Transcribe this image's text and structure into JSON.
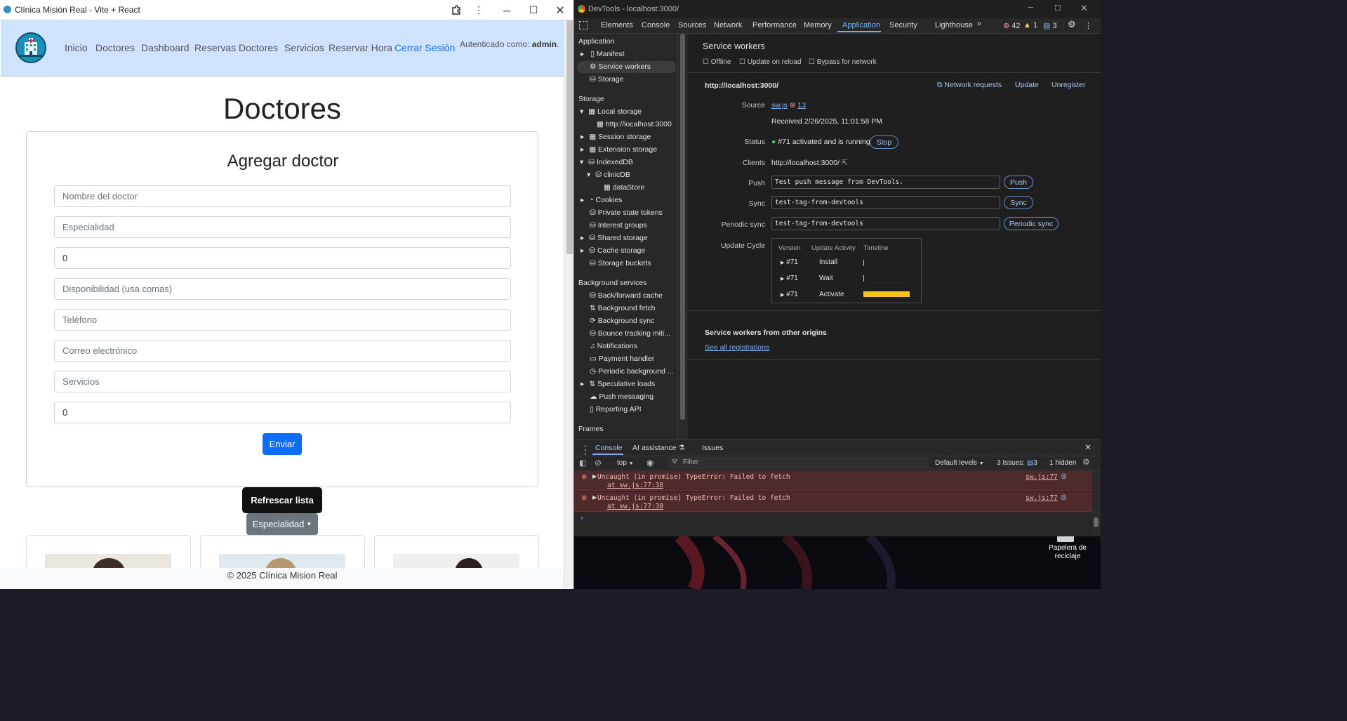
{
  "app": {
    "window_title": "Clínica Misión Real - Vite + React",
    "nav": [
      "Inicio",
      "Doctores",
      "Dashboard",
      "Reservas",
      "Doctores",
      "Servicios",
      "Reservar Hora"
    ],
    "logout": "Cerrar Sesión",
    "auth_prefix": "Autenticado como:",
    "auth_user": "admin",
    "page_title": "Doctores",
    "form": {
      "title": "Agregar doctor",
      "name_placeholder": "Nombre del doctor",
      "specialty_placeholder": "Especialidad",
      "num1_value": "0",
      "availability_placeholder": "Disponibilidad (usa comas)",
      "phone_placeholder": "Teléfono",
      "email_placeholder": "Correo electrónico",
      "services_placeholder": "Servicios",
      "num2_value": "0",
      "submit": "Enviar"
    },
    "refresh": "Refrescar lista",
    "specialty_dropdown": "Especialidad",
    "footer": "© 2025 Clínica Mision Real"
  },
  "devtools": {
    "window_title": "DevTools - localhost:3000/",
    "tabs": [
      "Elements",
      "Console",
      "Sources",
      "Network",
      "Performance",
      "Memory",
      "Application",
      "Security",
      "Lighthouse"
    ],
    "errors_count": "42",
    "warnings_count": "1",
    "issues_count": "3",
    "sidebar": {
      "application_header": "Application",
      "manifest": "Manifest",
      "service_workers": "Service workers",
      "storage_item": "Storage",
      "storage_header": "Storage",
      "local_storage": "Local storage",
      "localhost": "http://localhost:3000",
      "session_storage": "Session storage",
      "extension_storage": "Extension storage",
      "indexeddb": "IndexedDB",
      "clinicdb": "clinicDB",
      "datastore": "dataStore",
      "cookies": "Cookies",
      "private_state": "Private state tokens",
      "interest_groups": "Interest groups",
      "shared_storage": "Shared storage",
      "cache_storage": "Cache storage",
      "storage_buckets": "Storage buckets",
      "bg_header": "Background services",
      "bfcache": "Back/forward cache",
      "bg_fetch": "Background fetch",
      "bg_sync": "Background sync",
      "bounce": "Bounce tracking miti...",
      "notifications": "Notifications",
      "payment": "Payment handler",
      "periodic_bg": "Periodic background ...",
      "speculative": "Speculative loads",
      "push_messaging": "Push messaging",
      "reporting": "Reporting API",
      "frames_header": "Frames"
    },
    "sw": {
      "title": "Service workers",
      "offline": "Offline",
      "update_on_reload": "Update on reload",
      "bypass": "Bypass for network",
      "origin": "http://localhost:3000/",
      "network_requests": "Network requests",
      "update": "Update",
      "unregister": "Unregister",
      "source_label": "Source",
      "source_file": "sw.js",
      "source_errors": "13",
      "received": "Received 2/26/2025, 11:01:58 PM",
      "status_label": "Status",
      "status_text": "#71 activated and is running",
      "stop": "Stop",
      "clients_label": "Clients",
      "clients_value": "http://localhost:3000/",
      "push_label": "Push",
      "push_value": "Test push message from DevTools.",
      "push_btn": "Push",
      "sync_label": "Sync",
      "sync_value": "test-tag-from-devtools",
      "sync_btn": "Sync",
      "periodic_label": "Periodic sync",
      "periodic_value": "test-tag-from-devtools",
      "periodic_btn": "Periodic sync",
      "update_cycle_label": "Update Cycle",
      "uc_headers": [
        "Version",
        "Update Activity",
        "Timeline"
      ],
      "uc_rows": [
        {
          "version": "#71",
          "activity": "Install"
        },
        {
          "version": "#71",
          "activity": "Wait"
        },
        {
          "version": "#71",
          "activity": "Activate"
        }
      ],
      "other_origins": "Service workers from other origins",
      "see_all": "See all registrations"
    },
    "console": {
      "tabs": [
        "Console",
        "AI assistance",
        "Issues"
      ],
      "context": "top",
      "filter_placeholder": "Filter",
      "levels": "Default levels",
      "issues_label": "3 Issues:",
      "issues_count": "3",
      "hidden": "1 hidden",
      "errors": [
        {
          "line1": "Uncaught (in promise) TypeError: Failed to fetch",
          "line2": "at sw.js:77:38",
          "src": "sw.js:77"
        },
        {
          "line1": "Uncaught (in promise) TypeError: Failed to fetch",
          "line2": "at sw.js:77:38",
          "src": "sw.js:77"
        }
      ]
    }
  },
  "desktop": {
    "recycle_bin": "Papelera de reciclaje"
  }
}
